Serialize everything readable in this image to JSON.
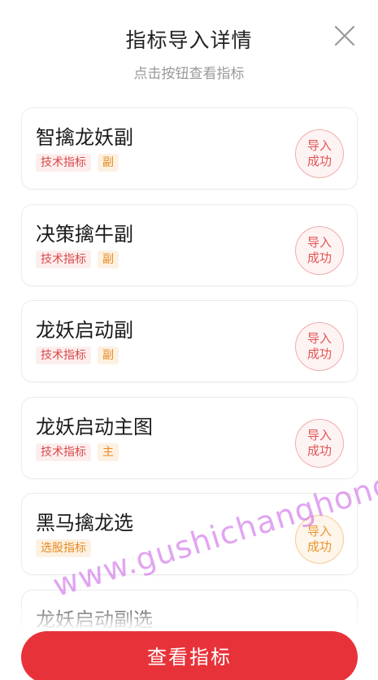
{
  "header": {
    "title": "指标导入详情",
    "subtitle": "点击按钮查看指标"
  },
  "colors": {
    "accent_red": "#e8323a",
    "tag_red_text": "#d94a4a",
    "tag_red_bg": "#fdeeee",
    "tag_orange_text": "#e68a1f",
    "tag_orange_bg": "#fdf1e3",
    "stamp_red": "#e05656",
    "stamp_orange": "#e8962f"
  },
  "items": [
    {
      "name": "智擒龙妖副",
      "tags": [
        "技术指标",
        "副"
      ],
      "status": "导入成功"
    },
    {
      "name": "决策擒牛副",
      "tags": [
        "技术指标",
        "副"
      ],
      "status": "导入成功"
    },
    {
      "name": "龙妖启动副",
      "tags": [
        "技术指标",
        "副"
      ],
      "status": "导入成功"
    },
    {
      "name": "龙妖启动主图",
      "tags": [
        "技术指标",
        "主"
      ],
      "status": "导入成功"
    },
    {
      "name": "黑马擒龙选",
      "tags": [
        "选股指标"
      ],
      "status": "导入成功"
    },
    {
      "name": "龙妖启动副选",
      "tags": [],
      "status": ""
    }
  ],
  "footer": {
    "button_label": "查看指标"
  },
  "watermark": "www.gushichanghong.com"
}
